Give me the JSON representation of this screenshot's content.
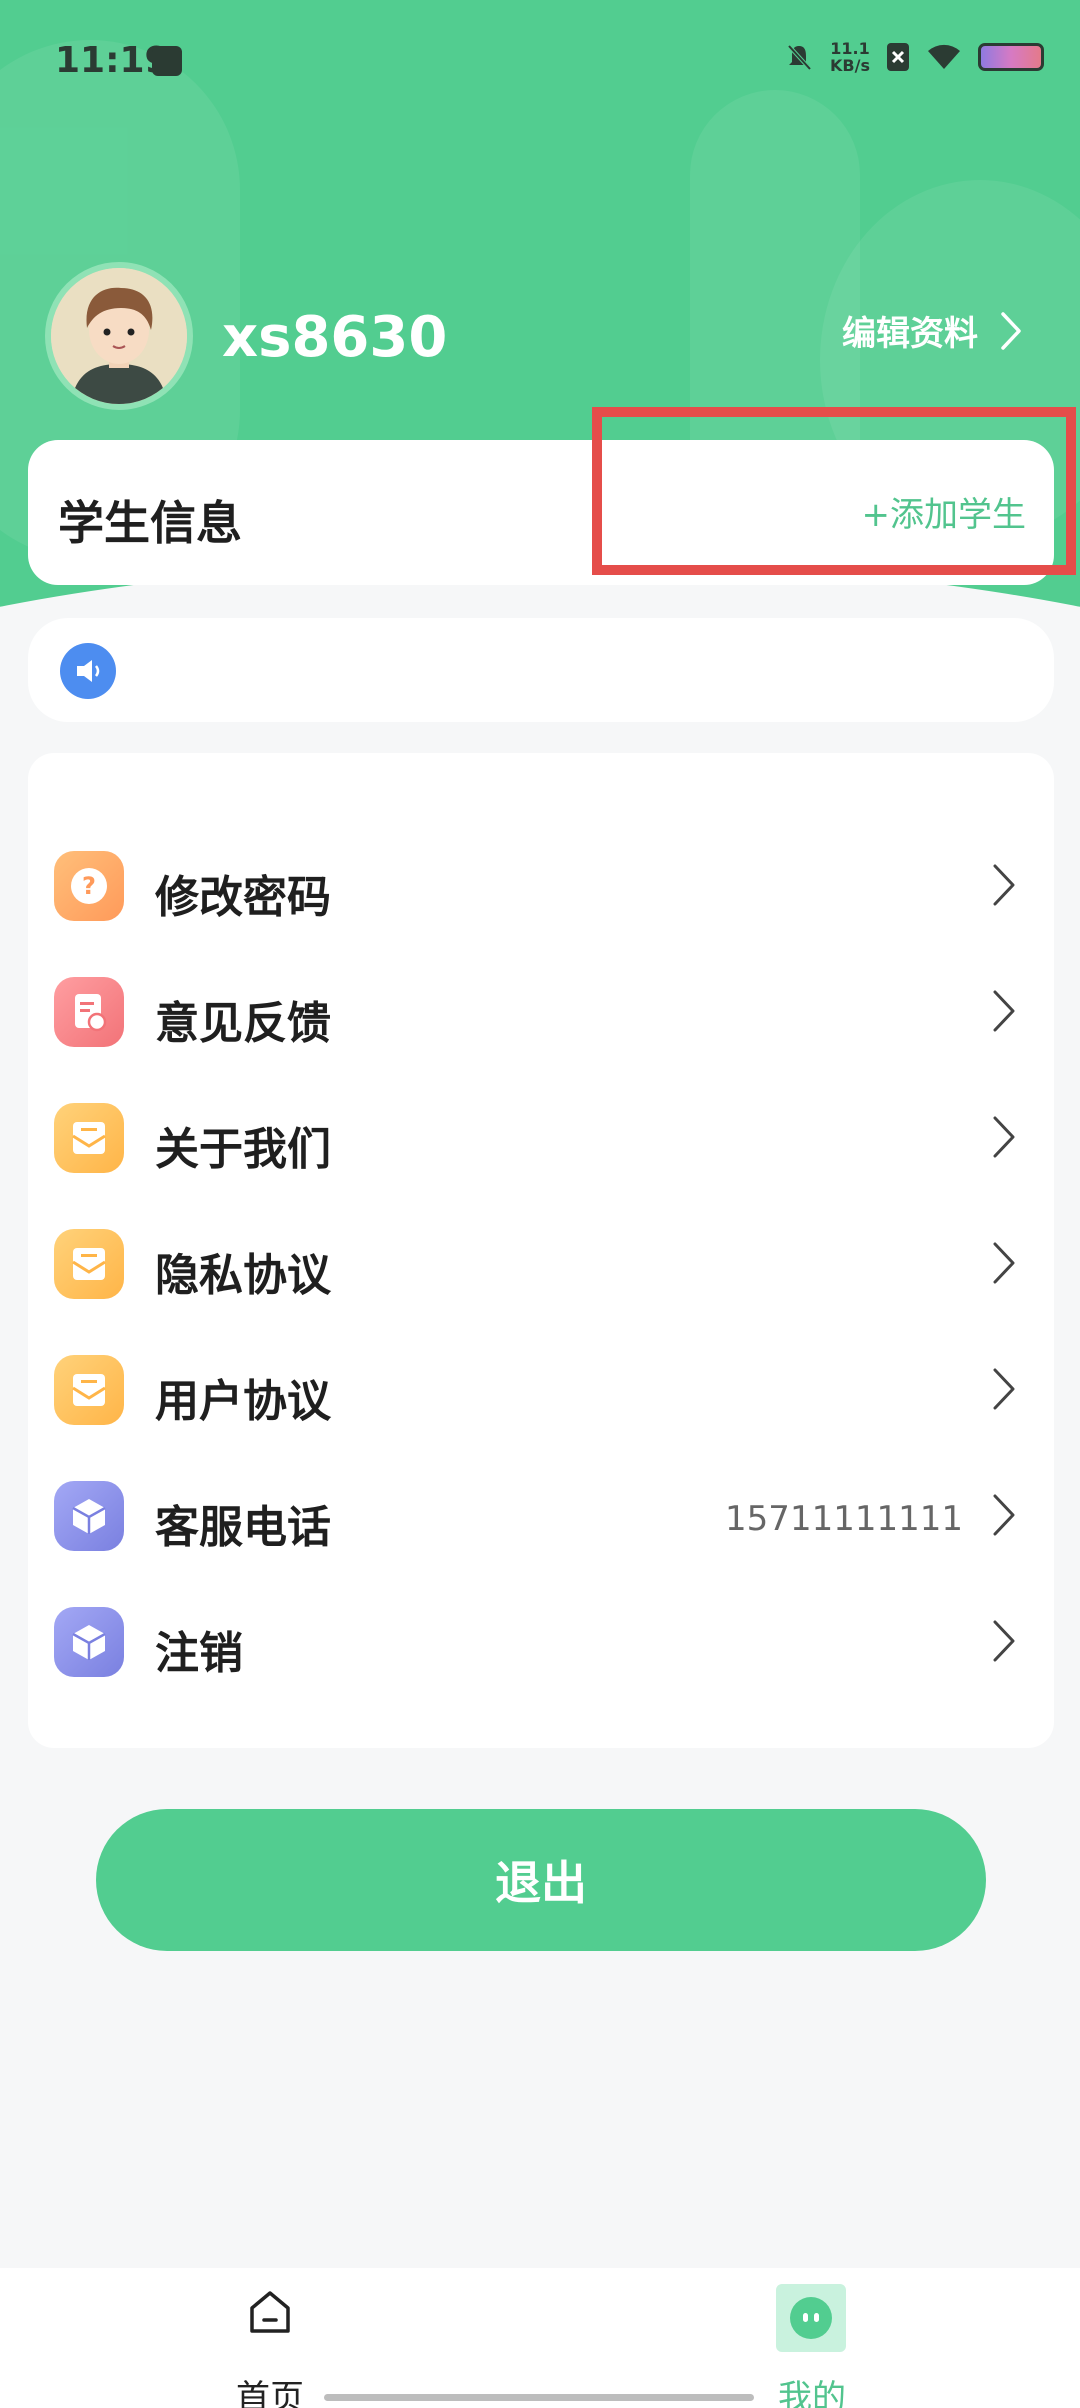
{
  "status_bar": {
    "time": "11:19",
    "network_speed_value": "11.1",
    "network_speed_unit": "KB/s"
  },
  "profile": {
    "username": "xs8630",
    "edit_label": "编辑资料"
  },
  "student_info": {
    "title": "学生信息",
    "add_label": "+添加学生"
  },
  "menu": {
    "items": [
      {
        "label": "修改密码",
        "icon": "question-icon",
        "value": ""
      },
      {
        "label": "意见反馈",
        "icon": "feedback-icon",
        "value": ""
      },
      {
        "label": "关于我们",
        "icon": "mail-icon",
        "value": ""
      },
      {
        "label": "隐私协议",
        "icon": "mail-icon",
        "value": ""
      },
      {
        "label": "用户协议",
        "icon": "mail-icon",
        "value": ""
      },
      {
        "label": "客服电话",
        "icon": "box-icon",
        "value": "15711111111"
      },
      {
        "label": "注销",
        "icon": "box-icon",
        "value": ""
      }
    ]
  },
  "logout_label": "退出",
  "tabbar": {
    "items": [
      {
        "label": "首页",
        "icon": "home-icon"
      },
      {
        "label": "我的",
        "icon": "profile-icon"
      }
    ]
  },
  "colors": {
    "accent": "#52cd90",
    "highlight": "#e54d4a",
    "text_primary": "#1f1f1f"
  }
}
